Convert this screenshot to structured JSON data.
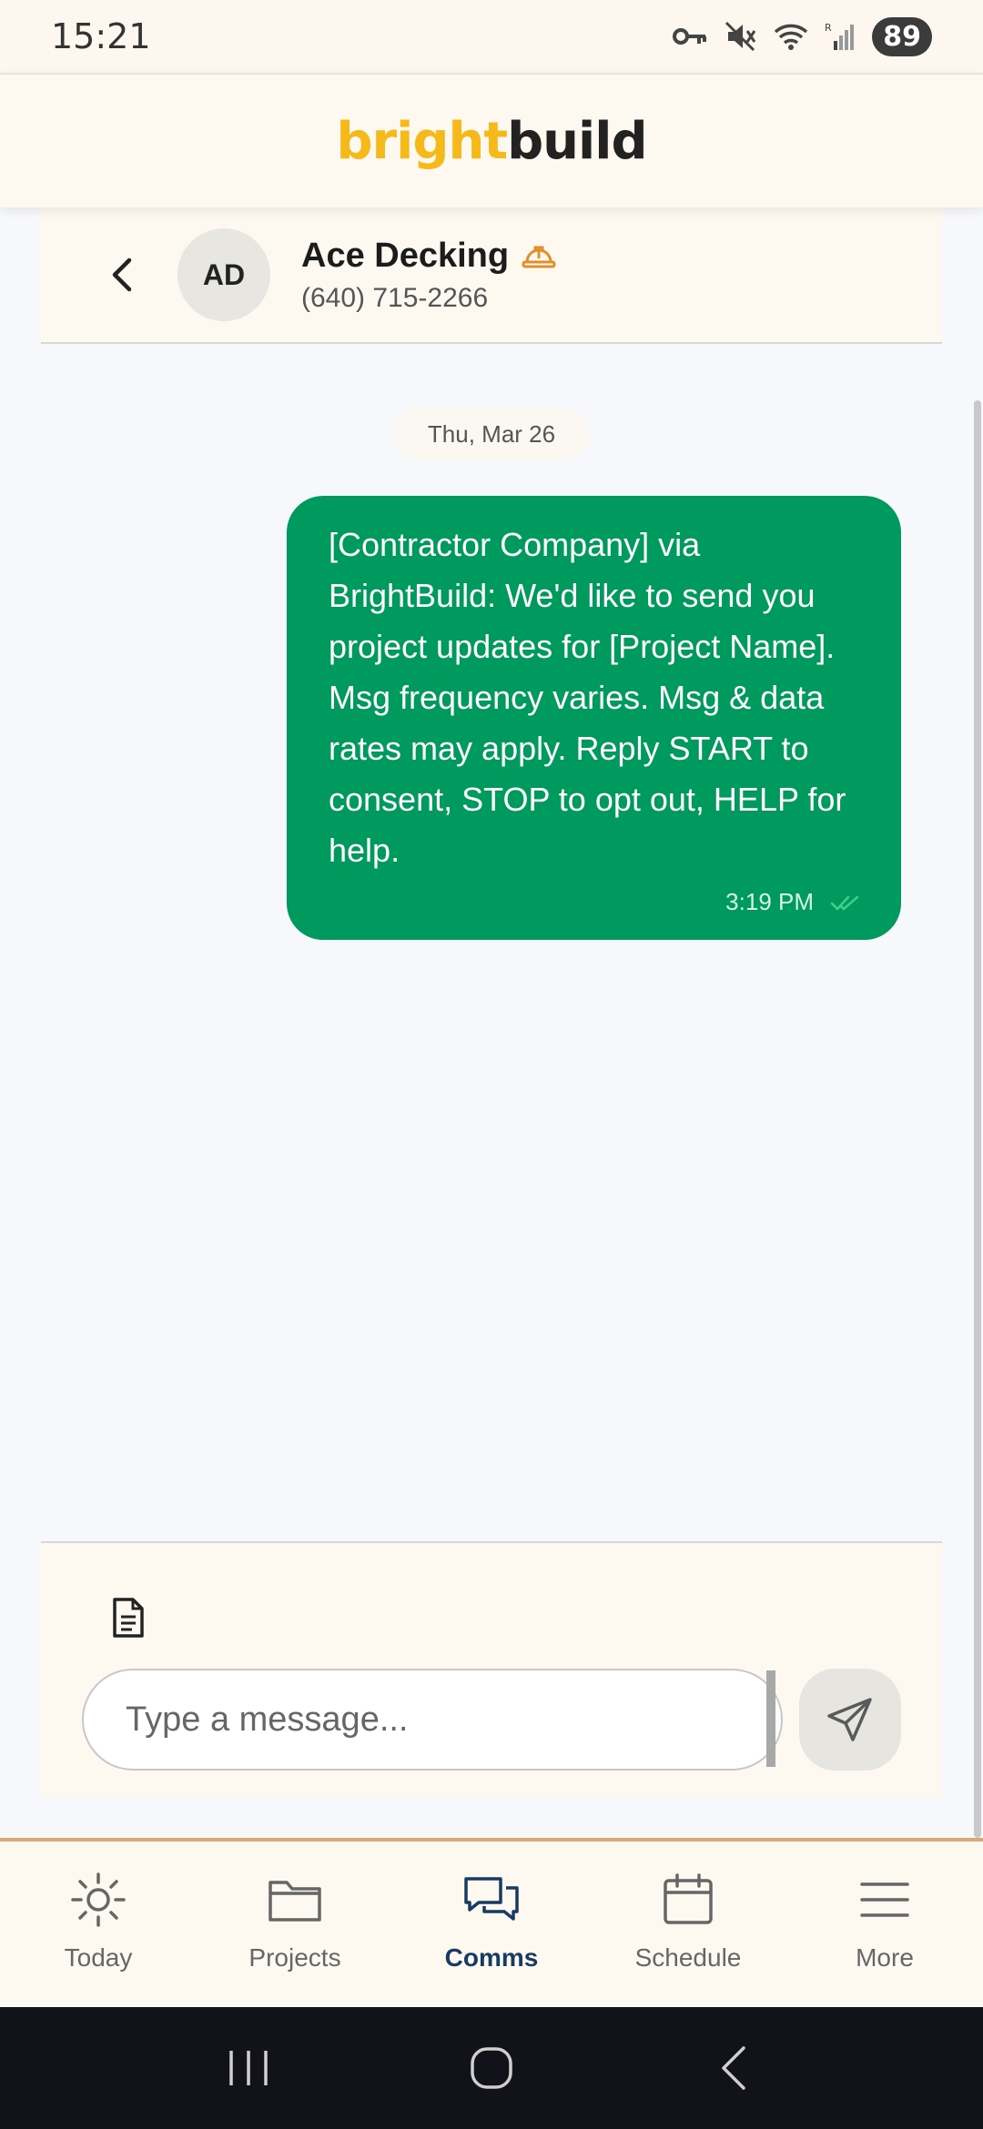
{
  "status_bar": {
    "time": "15:21",
    "battery": "89"
  },
  "app": {
    "logo_bright": "bright",
    "logo_build": "build"
  },
  "contact": {
    "initials": "AD",
    "name": "Ace Decking",
    "phone": "(640) 715-2266"
  },
  "chat": {
    "date_label": "Thu, Mar 26",
    "messages": [
      {
        "text": "[Contractor Company] via BrightBuild: We'd like to send you project updates for [Project Name]. Msg frequency varies. Msg & data rates may apply. Reply START to consent, STOP to opt out, HELP for help.",
        "time": "3:19 PM",
        "status_icon": "double-check-icon"
      }
    ]
  },
  "composer": {
    "placeholder": "Type a message..."
  },
  "nav": {
    "items": [
      {
        "label": "Today",
        "icon": "sun-icon"
      },
      {
        "label": "Projects",
        "icon": "folder-icon"
      },
      {
        "label": "Comms",
        "icon": "chat-bubbles-icon",
        "active": true
      },
      {
        "label": "Schedule",
        "icon": "calendar-icon"
      },
      {
        "label": "More",
        "icon": "menu-icon"
      }
    ]
  },
  "colors": {
    "accent_yellow": "#f5b91a",
    "bubble_green": "#009a5e",
    "nav_active": "#173b63",
    "nav_border": "#d9a77a",
    "hard_hat": "#e0902a"
  }
}
